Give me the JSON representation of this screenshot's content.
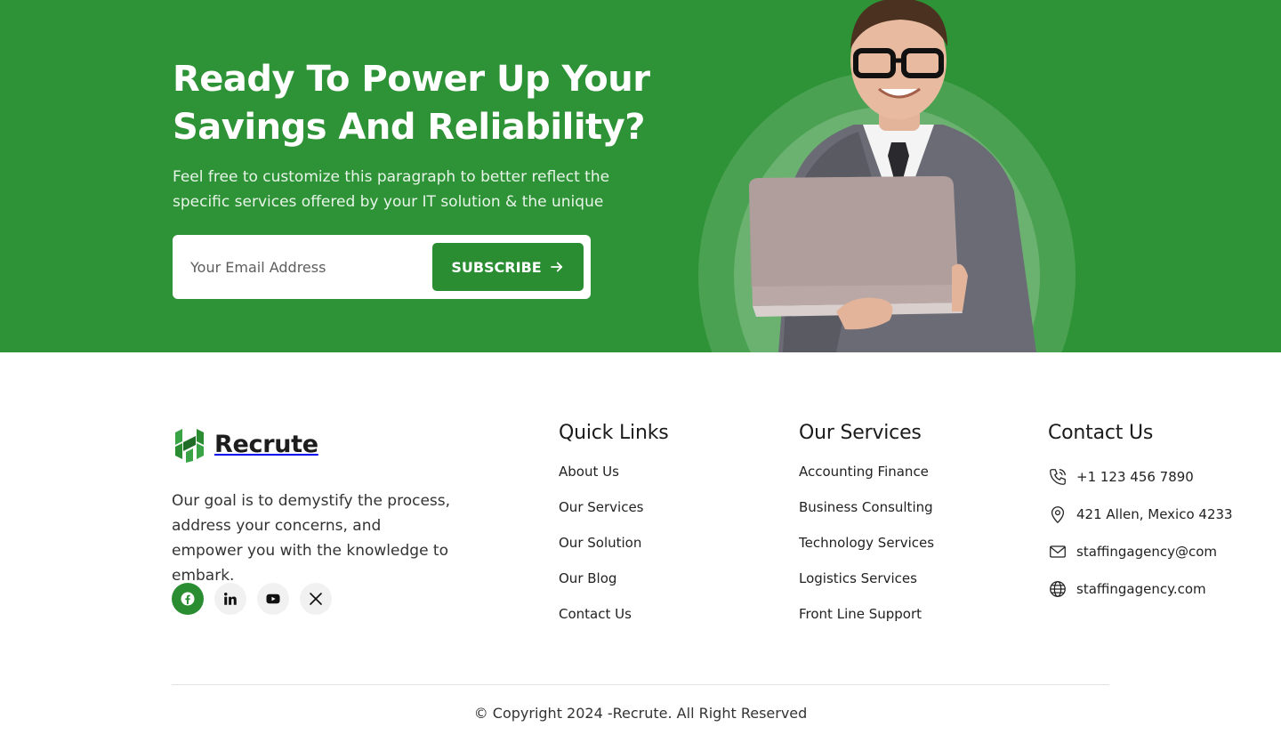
{
  "cta": {
    "title_line1": "Ready To Power Up Your",
    "title_line2": "Savings And Reliability?",
    "description": "Feel free to customize this paragraph to better reflect the specific services offered by your IT solution & the unique",
    "email_placeholder": "Your Email Address",
    "subscribe_label": "SUBSCRIBE",
    "accent_color": "#2e9236"
  },
  "brand": {
    "name": "Recrute",
    "logo_icon": "h-logo-icon",
    "about": "Our goal is to demystify the process, address your concerns, and empower you with the knowledge to embark."
  },
  "socials": [
    {
      "icon": "facebook-icon",
      "active": true
    },
    {
      "icon": "linkedin-icon",
      "active": false
    },
    {
      "icon": "youtube-icon",
      "active": false
    },
    {
      "icon": "x-icon",
      "active": false
    }
  ],
  "quick_links": {
    "title": "Quick Links",
    "items": [
      "About Us",
      "Our Services",
      "Our Solution",
      "Our Blog",
      "Contact Us"
    ]
  },
  "services": {
    "title": "Our Services",
    "items": [
      "Accounting Finance",
      "Business Consulting",
      "Technology Services",
      "Logistics Services",
      "Front Line Support"
    ]
  },
  "contact": {
    "title": "Contact Us",
    "phone": "+1 123 456 7890",
    "address": "421 Allen, Mexico 4233",
    "email": "staffingagency@com",
    "website": "staffingagency.com"
  },
  "copyright": "© Copyright 2024 -Recrute. All Right Reserved"
}
